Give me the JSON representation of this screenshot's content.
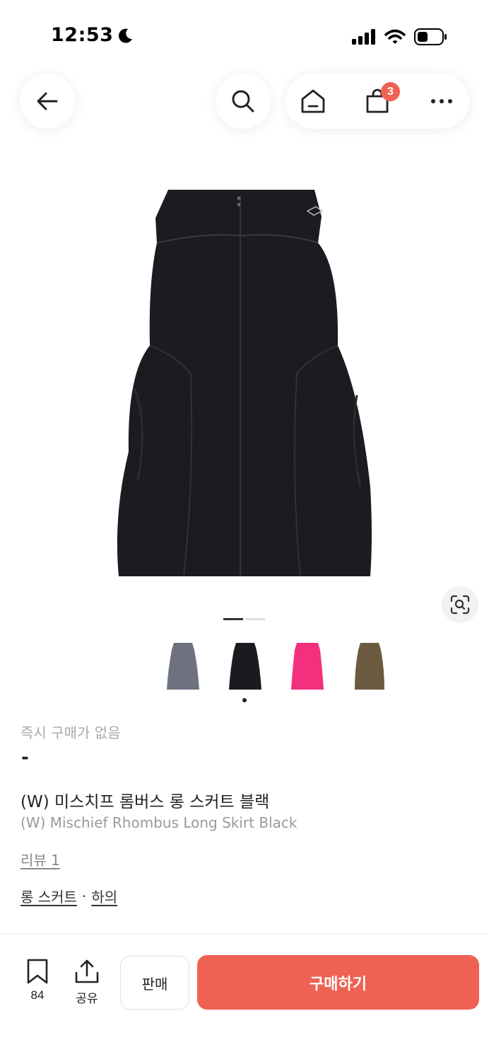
{
  "status_bar": {
    "time": "12:53"
  },
  "nav": {
    "cart_count": "3"
  },
  "gallery": {
    "thumbnails": [
      {
        "color": "#6d7180"
      },
      {
        "color": "#1a1b20"
      },
      {
        "color": "#f2307e"
      },
      {
        "color": "#6b5a3f"
      }
    ],
    "selected_index": 1
  },
  "product": {
    "availability": "즉시 구매가 없음",
    "price": "-",
    "name_ko": "(W) 미스치프 롬버스 롱 스커트 블랙",
    "name_en": "(W) Mischief Rhombus Long Skirt Black",
    "review_label": "리뷰 1",
    "category_1": "롱 스커트",
    "category_separator": "·",
    "category_2": "하의"
  },
  "bottom_bar": {
    "bookmark_count": "84",
    "share_label": "공유",
    "sell_label": "판매",
    "buy_label": "구매하기"
  },
  "colors": {
    "accent": "#ef6253"
  }
}
